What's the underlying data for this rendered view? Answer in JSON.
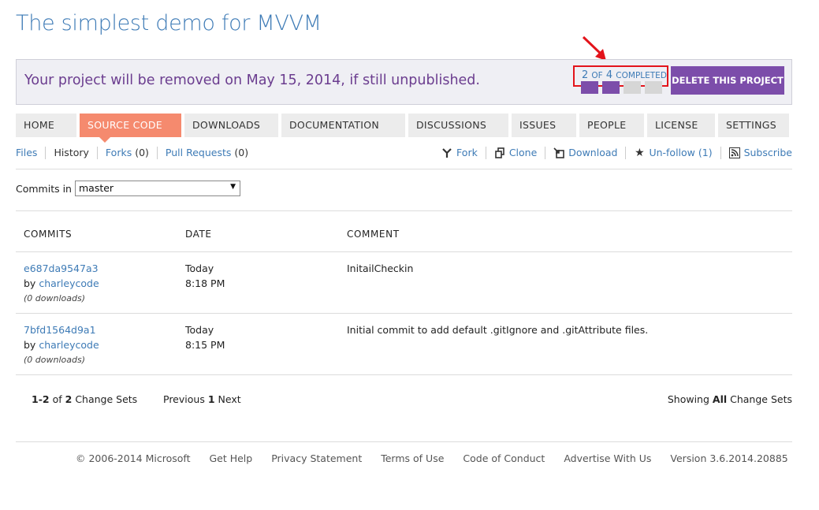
{
  "page_title": "The simplest demo for MVVM",
  "banner": {
    "message": "Your project will be removed on May 15, 2014, if still unpublished.",
    "progress": {
      "done": "2",
      "of": "OF",
      "total": "4",
      "label": "COMPLETED",
      "completed_fraction": 0.5,
      "steps": [
        true,
        true,
        false,
        false
      ]
    },
    "delete_label": "DELETE THIS PROJECT",
    "accent_color": "#7c4daa",
    "highlight_color": "#e3141b"
  },
  "tabs": [
    {
      "label": "HOME"
    },
    {
      "label": "SOURCE CODE",
      "active": true
    },
    {
      "label": "DOWNLOADS"
    },
    {
      "label": "DOCUMENTATION"
    },
    {
      "label": "DISCUSSIONS"
    },
    {
      "label": "ISSUES"
    },
    {
      "label": "PEOPLE"
    },
    {
      "label": "LICENSE"
    },
    {
      "label": "SETTINGS"
    }
  ],
  "subnav": {
    "files": "Files",
    "history": "History",
    "forks": "Forks",
    "forks_count": "(0)",
    "pull_requests": "Pull Requests",
    "pull_requests_count": "(0)"
  },
  "actions": {
    "fork": "Fork",
    "clone": "Clone",
    "download": "Download",
    "unfollow": "Un-follow (1)",
    "subscribe": "Subscribe"
  },
  "branch": {
    "label": "Commits in",
    "selected": "master"
  },
  "table": {
    "headers": [
      "COMMITS",
      "DATE",
      "COMMENT"
    ],
    "rows": [
      {
        "id": "e687da9547a3",
        "by": "by",
        "author": "charleycode",
        "downloads": "(0 downloads)",
        "day": "Today",
        "time": "8:18 PM",
        "comment": "InitailCheckin"
      },
      {
        "id": "7bfd1564d9a1",
        "by": "by",
        "author": "charleycode",
        "downloads": "(0 downloads)",
        "day": "Today",
        "time": "8:15 PM",
        "comment": "Initial commit to add default .gitIgnore and .gitAttribute files."
      }
    ]
  },
  "pager": {
    "range": "1-2",
    "of": "of",
    "total": "2",
    "unit": "Change Sets",
    "previous": "Previous",
    "page": "1",
    "next": "Next",
    "showing": "Showing",
    "all": "All",
    "showing_unit": "Change Sets"
  },
  "footer": [
    "© 2006-2014 Microsoft",
    "Get Help",
    "Privacy Statement",
    "Terms of Use",
    "Code of Conduct",
    "Advertise With Us",
    "Version 3.6.2014.20885"
  ]
}
